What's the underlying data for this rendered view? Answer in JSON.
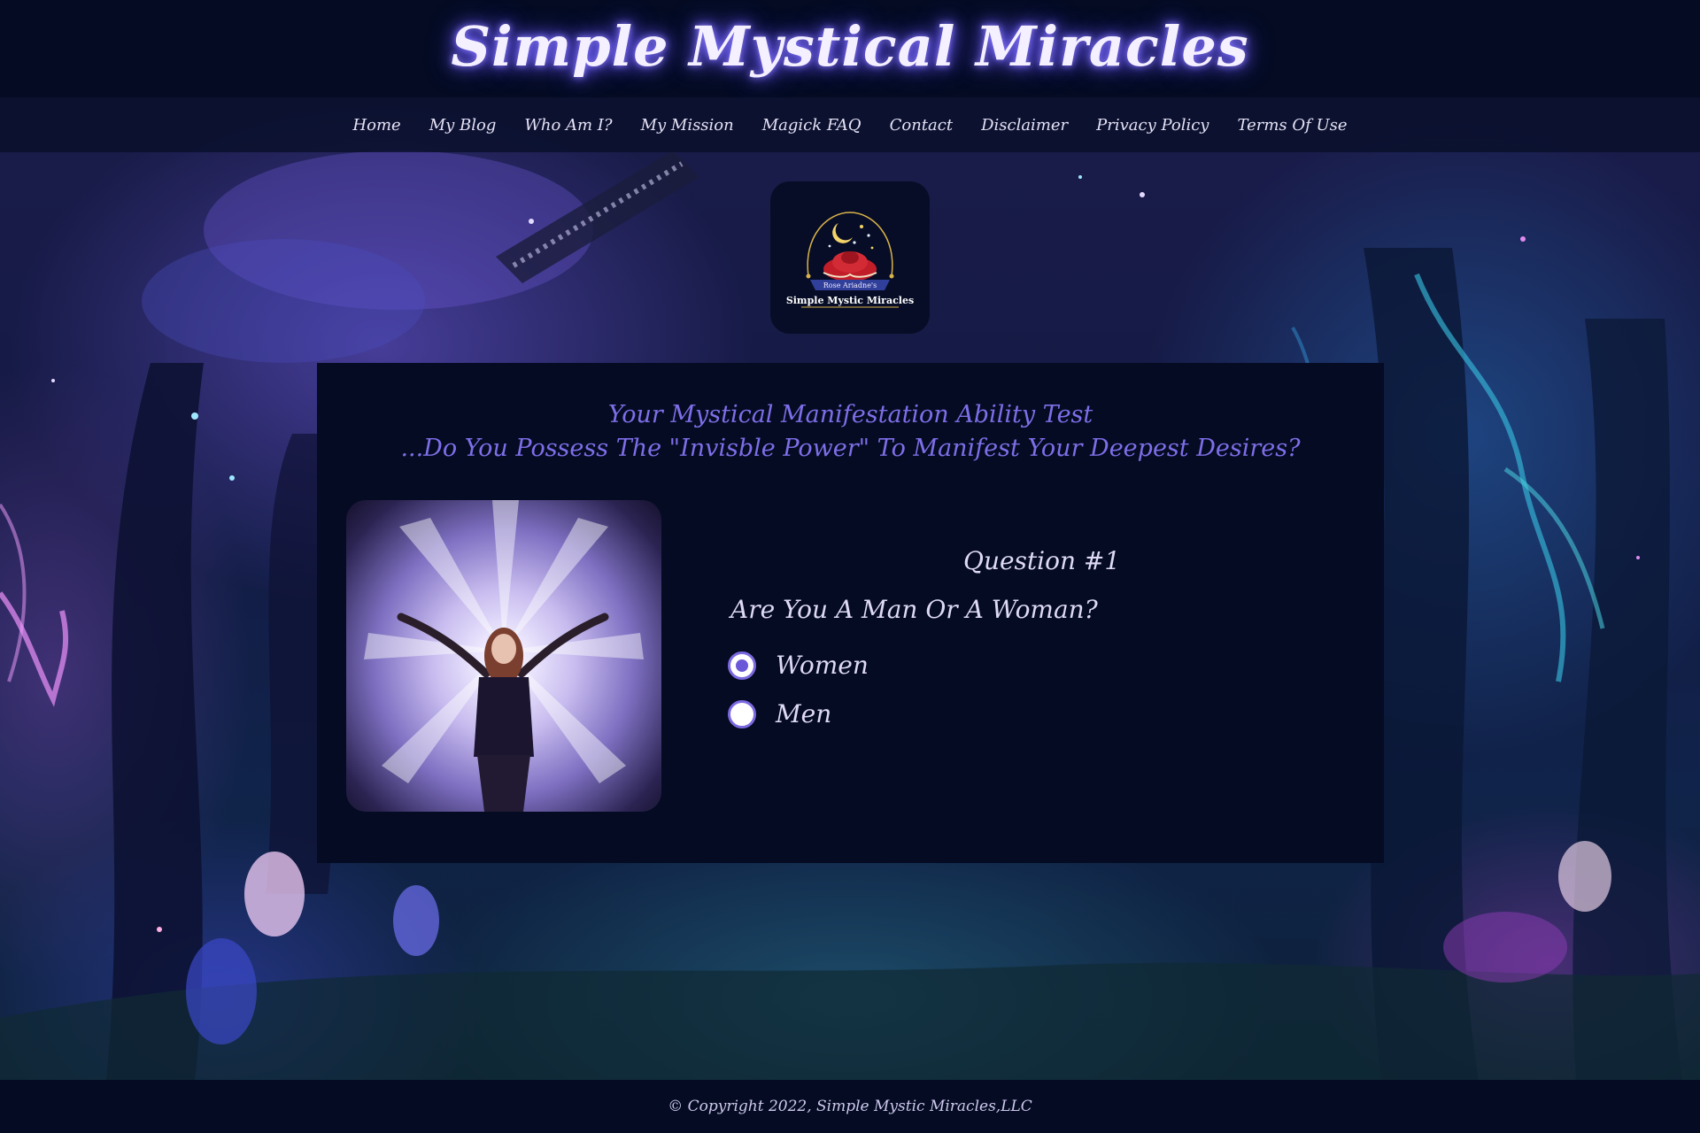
{
  "header": {
    "title": "Simple Mystical Miracles"
  },
  "nav": {
    "items": [
      {
        "label": "Home"
      },
      {
        "label": "My Blog"
      },
      {
        "label": "Who Am I?"
      },
      {
        "label": "My Mission"
      },
      {
        "label": "Magick FAQ"
      },
      {
        "label": "Contact"
      },
      {
        "label": "Disclaimer"
      },
      {
        "label": "Privacy Policy"
      },
      {
        "label": "Terms Of Use"
      }
    ]
  },
  "logo": {
    "top_text": "Rose Ariadne's",
    "bottom_text": "Simple Mystic Miracles"
  },
  "quiz": {
    "heading_line1": "Your Mystical Manifestation Ability Test",
    "heading_line2": "...Do You Possess The \"Invisble Power\" To Manifest Your Deepest Desires?",
    "question_number": "Question #1",
    "question_text": "Are You A Man Or A Woman?",
    "options": [
      {
        "label": "Women",
        "selected": true
      },
      {
        "label": "Men",
        "selected": false
      }
    ]
  },
  "footer": {
    "copyright": "© Copyright 2022, Simple Mystic Miracles,LLC"
  },
  "colors": {
    "page_background": "#040b22",
    "heading_accent": "#7e6ee8",
    "radio_accent": "#6b58d8",
    "title_glow": "#8a7bff"
  }
}
